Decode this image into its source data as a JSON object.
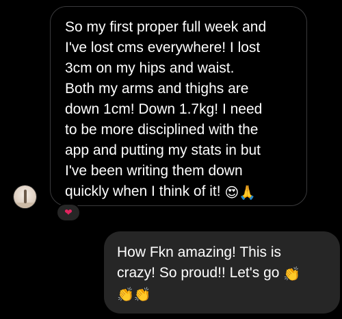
{
  "thread": {
    "incoming": {
      "lines": [
        "So my first proper full week and",
        "I've lost cms everywhere! I lost",
        "3cm on my hips and waist.",
        "Both my arms and thighs are",
        "down 1cm! Down 1.7kg! I need",
        "to be more disciplined with the",
        "app and putting my stats in but",
        "I've been writing them down",
        "quickly when I think of it!"
      ],
      "emoji_1": "😍",
      "emoji_2": "🙏",
      "reaction": "❤"
    },
    "outgoing": {
      "lines": [
        "How Fkn amazing! This is",
        "crazy! So proud!! Let's go"
      ],
      "emoji_1": "👏",
      "emoji_2": "👏",
      "emoji_3": "👏"
    }
  }
}
